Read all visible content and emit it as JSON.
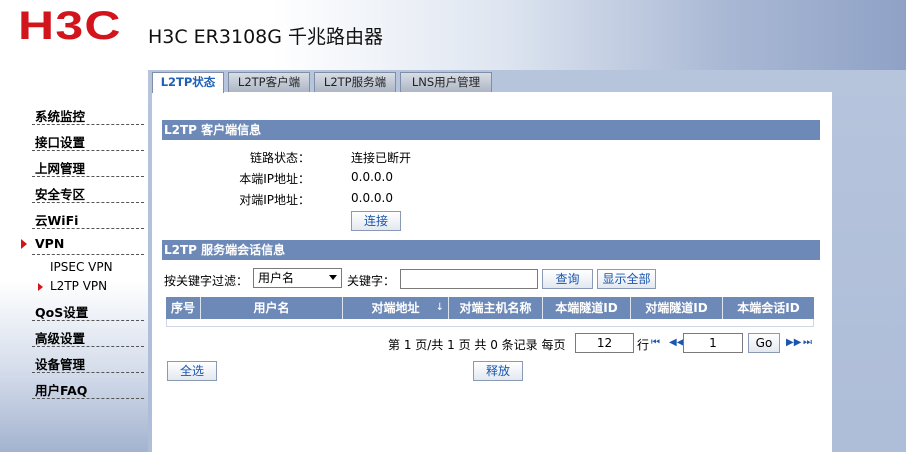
{
  "header": {
    "logo": "H3C",
    "product": "H3C ER3108G 千兆路由器"
  },
  "sidebar": {
    "items": [
      {
        "label": "系统监控"
      },
      {
        "label": "接口设置"
      },
      {
        "label": "上网管理"
      },
      {
        "label": "安全专区"
      },
      {
        "label": "云WiFi"
      },
      {
        "label": "VPN"
      },
      {
        "label": "QoS设置"
      },
      {
        "label": "高级设置"
      },
      {
        "label": "设备管理"
      },
      {
        "label": "用户FAQ"
      }
    ],
    "vpn_sub": [
      {
        "label": "IPSEC VPN"
      },
      {
        "label": "L2TP VPN"
      }
    ]
  },
  "tabs": [
    {
      "label": "L2TP状态"
    },
    {
      "label": "L2TP客户端"
    },
    {
      "label": "L2TP服务端"
    },
    {
      "label": "LNS用户管理"
    }
  ],
  "client_info": {
    "title": "L2TP 客户端信息",
    "link_status_label": "链路状态：",
    "link_status_value": "连接已断开",
    "local_ip_label": "本端IP地址：",
    "local_ip_value": "0.0.0.0",
    "remote_ip_label": "对端IP地址：",
    "remote_ip_value": "0.0.0.0",
    "connect_button": "连接"
  },
  "server_info": {
    "title": "L2TP 服务端会话信息",
    "filter_label": "按关键字过滤：",
    "filter_selected": "用户名",
    "keyword_label": "关键字：",
    "keyword_value": "",
    "query_button": "查询",
    "show_all_button": "显示全部",
    "columns": [
      "序号",
      "用户名",
      "对端地址",
      "对端主机名称",
      "本端隧道ID",
      "对端隧道ID",
      "本端会话ID"
    ],
    "sort_indicator": "↓"
  },
  "pager": {
    "text": "第 1 页/共 1 页 共 0 条记录 每页",
    "per_page": "12",
    "row_label": "行",
    "page_input": "1",
    "go_button": "Go"
  },
  "actions": {
    "select_all": "全选",
    "release": "释放"
  },
  "colors": {
    "logo": "#d2151c",
    "section_bar": "#6d89b8",
    "link_blue": "#1a56b0"
  }
}
